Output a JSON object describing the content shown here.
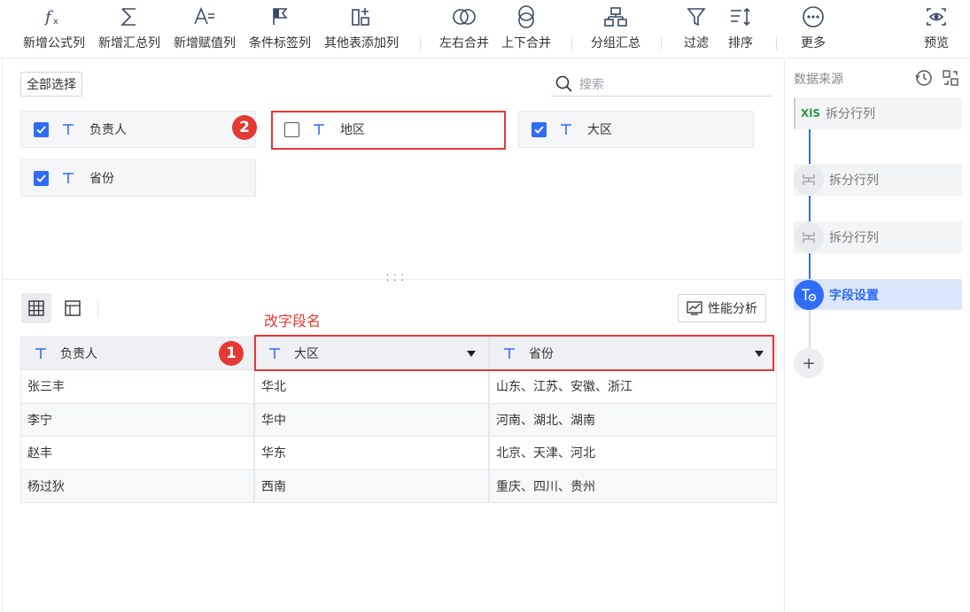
{
  "toolbar": {
    "items": [
      {
        "label": "新增公式列",
        "icon": "formula-icon"
      },
      {
        "label": "新增汇总列",
        "icon": "sigma-icon"
      },
      {
        "label": "新增赋值列",
        "icon": "assign-icon"
      },
      {
        "label": "条件标签列",
        "icon": "flag-icon"
      },
      {
        "label": "其他表添加列",
        "icon": "add-column-icon"
      },
      {
        "label": "左右合并",
        "icon": "merge-lr-icon"
      },
      {
        "label": "上下合并",
        "icon": "merge-tb-icon"
      },
      {
        "label": "分组汇总",
        "icon": "group-icon"
      },
      {
        "label": "过滤",
        "icon": "filter-icon"
      },
      {
        "label": "排序",
        "icon": "sort-icon"
      },
      {
        "label": "更多",
        "icon": "more-icon"
      },
      {
        "label": "预览",
        "icon": "preview-icon"
      }
    ]
  },
  "fields": {
    "select_all": "全部选择",
    "search_placeholder": "搜索",
    "items": [
      {
        "name": "负责人",
        "checked": true
      },
      {
        "name": "地区",
        "checked": false
      },
      {
        "name": "大区",
        "checked": true
      },
      {
        "name": "省份",
        "checked": true
      }
    ]
  },
  "annotations": {
    "badge1": "1",
    "badge2": "2",
    "rename_note": "改字段名"
  },
  "preview": {
    "perf_label": "性能分析",
    "columns": [
      "负责人",
      "大区",
      "省份"
    ],
    "rows": [
      [
        "张三丰",
        "华北",
        "山东、江苏、安徽、浙江"
      ],
      [
        "李宁",
        "华中",
        "河南、湖北、湖南"
      ],
      [
        "赵丰",
        "华东",
        "北京、天津、河北"
      ],
      [
        "杨过狄",
        "西南",
        "重庆、四川、贵州"
      ]
    ]
  },
  "right_panel": {
    "title": "数据来源",
    "steps": [
      {
        "label": "拆分行列",
        "icon": "xls-icon"
      },
      {
        "label": "拆分行列",
        "icon": "split-icon"
      },
      {
        "label": "拆分行列",
        "icon": "split-icon"
      },
      {
        "label": "字段设置",
        "icon": "field-settings-icon",
        "current": true
      }
    ]
  },
  "colors": {
    "accent": "#2f6df6",
    "annotation": "#e53935"
  }
}
